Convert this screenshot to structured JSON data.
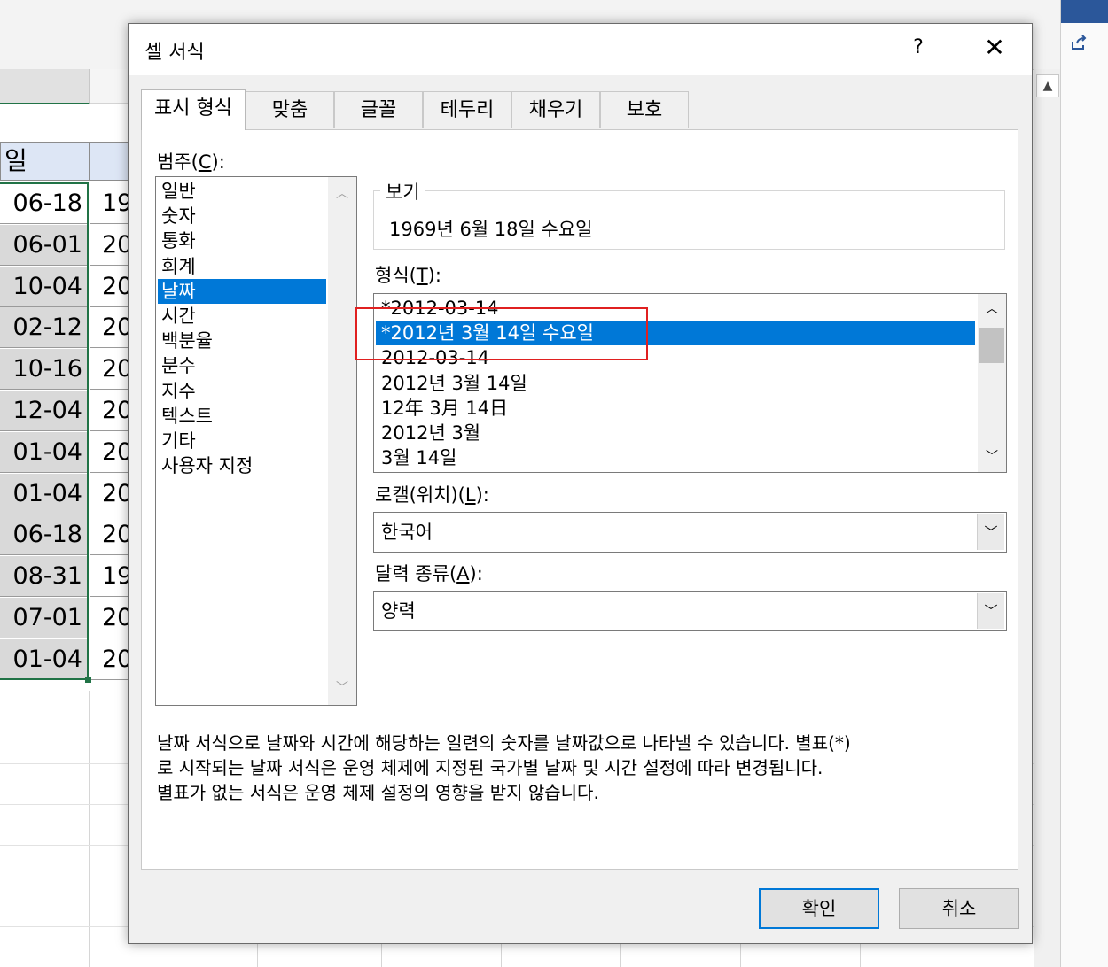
{
  "spreadsheet": {
    "header_cell_a": "일",
    "rows": [
      {
        "a": "06-18",
        "b": "19"
      },
      {
        "a": "06-01",
        "b": "20"
      },
      {
        "a": "10-04",
        "b": "20"
      },
      {
        "a": "02-12",
        "b": "20"
      },
      {
        "a": "10-16",
        "b": "20"
      },
      {
        "a": "12-04",
        "b": "20"
      },
      {
        "a": "01-04",
        "b": "20"
      },
      {
        "a": "01-04",
        "b": "20"
      },
      {
        "a": "06-18",
        "b": "20"
      },
      {
        "a": "08-31",
        "b": "19"
      },
      {
        "a": "07-01",
        "b": "20"
      },
      {
        "a": "01-04",
        "b": "20"
      }
    ]
  },
  "dialog": {
    "title": "셀 서식",
    "help_label": "?",
    "close_label": "✕",
    "tabs": [
      "표시 형식",
      "맞춤",
      "글꼴",
      "테두리",
      "채우기",
      "보호"
    ],
    "category": {
      "label": "범주(",
      "accel": "C",
      "label_end": "):",
      "items": [
        "일반",
        "숫자",
        "통화",
        "회계",
        "날짜",
        "시간",
        "백분율",
        "분수",
        "지수",
        "텍스트",
        "기타",
        "사용자 지정"
      ],
      "selected": "날짜"
    },
    "preview": {
      "label": "보기",
      "value": "1969년 6월 18일 수요일"
    },
    "format": {
      "label": "형식(",
      "accel": "T",
      "label_end": "):",
      "items": [
        "*2012-03-14",
        "*2012년 3월 14일 수요일",
        "2012-03-14",
        "2012년 3월 14일",
        "12年 3月 14日",
        "2012년 3월",
        "3월 14일"
      ],
      "selected": "*2012년 3월 14일 수요일"
    },
    "locale": {
      "label": "로캘(위치)(",
      "accel": "L",
      "label_end": "):",
      "value": "한국어"
    },
    "calendar": {
      "label": "달력 종류(",
      "accel": "A",
      "label_end": "):",
      "value": "양력"
    },
    "description": [
      "날짜 서식으로 날짜와 시간에 해당하는 일련의 숫자를 날짜값으로 나타낼 수 있습니다. 별표(*)",
      "로 시작되는 날짜 서식은 운영 체제에 지정된 국가별 날짜 및 시간 설정에 따라 변경됩니다.",
      "별표가 없는 서식은 운영 체제 설정의 영향을 받지 않습니다."
    ],
    "ok_label": "확인",
    "cancel_label": "취소"
  },
  "colors": {
    "selection_blue": "#0078d7",
    "highlight_red": "#e02020",
    "excel_green": "#217346"
  }
}
